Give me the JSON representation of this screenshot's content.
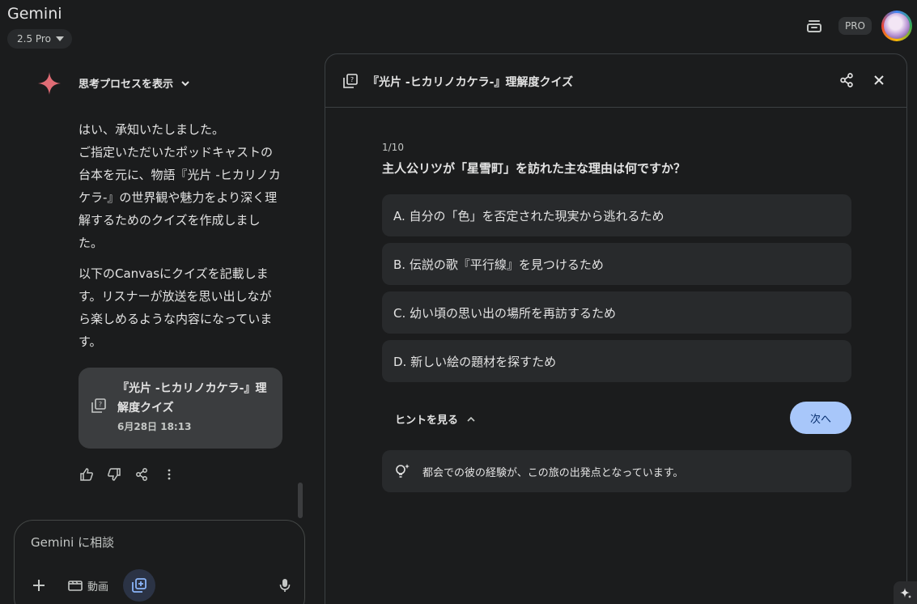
{
  "header": {
    "app_title": "Gemini",
    "model_label": "2.5 Pro",
    "pro_badge": "PRO"
  },
  "chat": {
    "thinking_label": "思考プロセスを表示",
    "message_paragraphs": [
      "はい、承知いたしました。\nご指定いただいたポッドキャストの台本を元に、物語『光片 -ヒカリノカケラ-』の世界観や魅力をより深く理解するためのクイズを作成しました。",
      "以下のCanvasにクイズを記載します。リスナーが放送を思い出しながら楽しめるような内容になっています。"
    ],
    "canvas_card": {
      "title": "『光片 -ヒカリノカケラ-』理解度クイズ",
      "date": "6月28日 18:13"
    }
  },
  "input": {
    "placeholder": "Gemini に相談",
    "video_label": "動画"
  },
  "panel": {
    "title": "『光片 -ヒカリノカケラ-』理解度クイズ",
    "progress": "1/10",
    "question": "主人公リツが「星雪町」を訪れた主な理由は何ですか？",
    "options": [
      "A.  自分の「色」を否定された現実から逃れるため",
      "B.  伝説の歌『平行線』を見つけるため",
      "C.  幼い頃の思い出の場所を再訪するため",
      "D.  新しい絵の題材を探すため"
    ],
    "hint_toggle": "ヒントを見る",
    "next_label": "次へ",
    "hint_text": "都会での彼の経験が、この旅の出発点となっています。"
  },
  "colors": {
    "background": "#1b1c1d",
    "surface": "#282a2c",
    "accent_button": "#a8c7fa",
    "spark": "#e06c75"
  }
}
